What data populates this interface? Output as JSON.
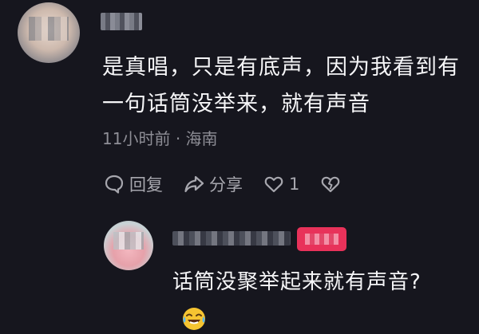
{
  "comment": {
    "text_line1": "是真唱，只是有底声，因为我看到有",
    "text_line2": "一句话筒没举来，就有声音",
    "time": "11小时前",
    "separator": "·",
    "location": "海南",
    "actions": {
      "reply_label": "回复",
      "share_label": "分享",
      "like_count": "1"
    }
  },
  "reply": {
    "text": "话筒没聚举起来就有声音?",
    "emoji": "laughing-crying-emoji"
  },
  "colors": {
    "background": "#16161e",
    "text": "#f5f5f7",
    "muted": "#8e8e96",
    "badge": "#e8325a"
  }
}
